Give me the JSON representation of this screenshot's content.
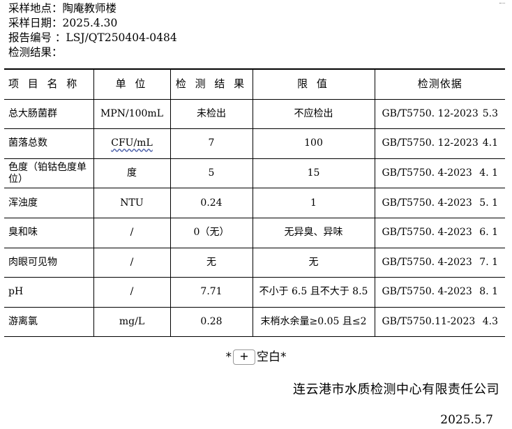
{
  "meta": [
    {
      "label": "采样地点：",
      "value": "陶庵教师楼"
    },
    {
      "label": "采样日期：",
      "value": "2025.4.30"
    },
    {
      "label": "报告编号 ：",
      "value": "LSJ/QT250404-0484"
    },
    {
      "label": "检测结果：",
      "value": ""
    }
  ],
  "table": {
    "headers": [
      "项 目 名 称",
      "单 位",
      "检 测 结 果",
      "限 值",
      "检测依据"
    ],
    "rows": [
      {
        "item": "总大肠菌群",
        "unit": "MPN/100mL",
        "result": "未检出",
        "limit": "不应检出",
        "standard": "GB/T5750. 12-2023",
        "clause": "5.3"
      },
      {
        "item": "菌落总数",
        "unit": "CFU/mL",
        "result": "7",
        "limit": "100",
        "standard": "GB/T5750. 12-2023",
        "clause": "4.1"
      },
      {
        "item": "色度（铂钴色度单位）",
        "unit": "度",
        "result": "5",
        "limit": "15",
        "standard": "GB/T5750. 4-2023",
        "clause": "4. 1"
      },
      {
        "item": "浑浊度",
        "unit": "NTU",
        "result": "0.24",
        "limit": "1",
        "standard": "GB/T5750. 4-2023",
        "clause": "5. 1"
      },
      {
        "item": "臭和味",
        "unit": "/",
        "result": "0（无）",
        "limit": "无异臭、异味",
        "standard": "GB/T5750. 4-2023",
        "clause": "6. 1"
      },
      {
        "item": "肉眼可见物",
        "unit": "/",
        "result": "无",
        "limit": "无",
        "standard": "GB/T5750. 4-2023",
        "clause": "7. 1"
      },
      {
        "item": "pH",
        "unit": "/",
        "result": "7.71",
        "limit": "不小于 6.5 且不大于 8.5",
        "standard": "GB/T5750. 4-2023",
        "clause": "8. 1"
      },
      {
        "item": "游离氯",
        "unit": "mg/L",
        "result": "0.28",
        "limit": "末梢水余量≥0.05 且≤2",
        "standard": "GB/T5750.11-2023",
        "clause": "4.3"
      }
    ]
  },
  "blank_note": {
    "prefix": "*",
    "button": "+",
    "text": "空白*"
  },
  "footer": {
    "company": "连云港市水质检测中心有限责任公司",
    "date": "2025.5.7"
  }
}
